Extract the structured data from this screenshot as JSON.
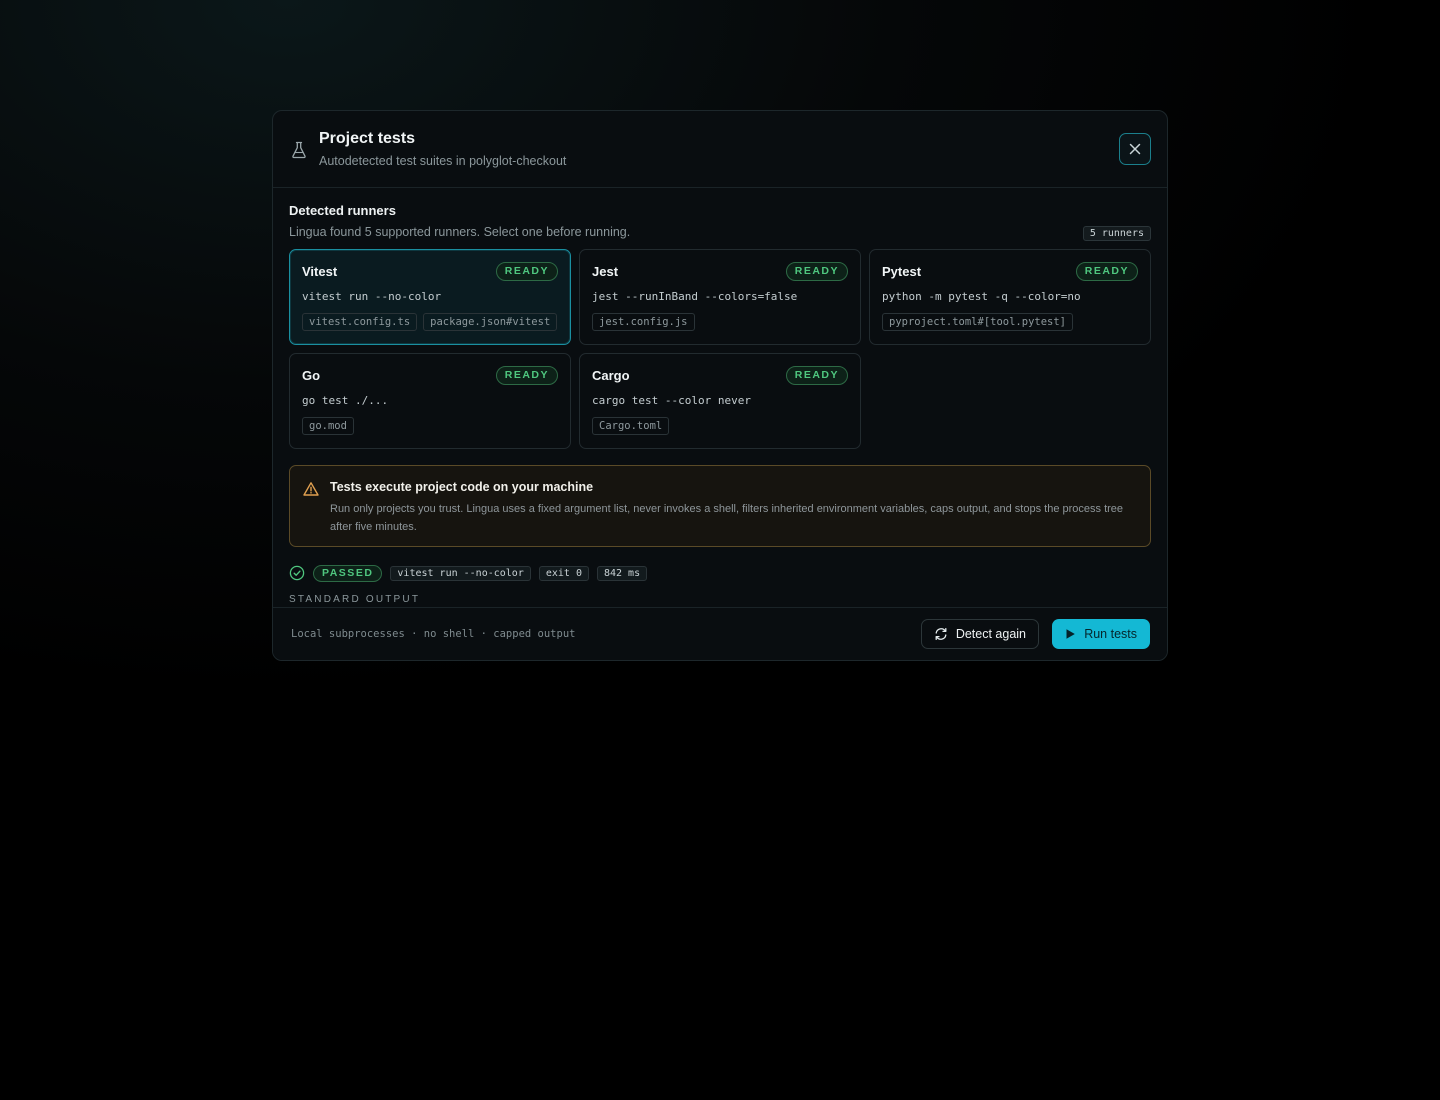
{
  "dialog": {
    "title": "Project tests",
    "subtitle": "Autodetected test suites in polyglot-checkout",
    "close_icon": "close-icon",
    "header_icon": "flask-icon"
  },
  "runners_section": {
    "title": "Detected runners",
    "description": "Lingua found 5 supported runners. Select one before running.",
    "count_badge": "5 runners",
    "selected": "Vitest",
    "runners": [
      {
        "name": "Vitest",
        "status": "READY",
        "command": "vitest run --no-color",
        "files": [
          "vitest.config.ts",
          "package.json#vitest"
        ]
      },
      {
        "name": "Jest",
        "status": "READY",
        "command": "jest --runInBand --colors=false",
        "files": [
          "jest.config.js"
        ]
      },
      {
        "name": "Pytest",
        "status": "READY",
        "command": "python -m pytest -q --color=no",
        "files": [
          "pyproject.toml#[tool.pytest]"
        ]
      },
      {
        "name": "Go",
        "status": "READY",
        "command": "go test ./...",
        "files": [
          "go.mod"
        ]
      },
      {
        "name": "Cargo",
        "status": "READY",
        "command": "cargo test --color never",
        "files": [
          "Cargo.toml"
        ]
      }
    ]
  },
  "warning": {
    "icon": "warning-triangle-icon",
    "title": "Tests execute project code on your machine",
    "body": "Run only projects you trust. Lingua uses a fixed argument list, never invokes a shell, filters inherited environment variables, caps output, and stops the process tree after five minutes."
  },
  "result": {
    "icon": "check-circle-icon",
    "status": "PASSED",
    "command": "vitest run --no-color",
    "exit": "exit 0",
    "duration": "842 ms",
    "stdout_label": "STANDARD OUTPUT"
  },
  "footer": {
    "note": "Local subprocesses · no shell · capped output",
    "detect_label": "Detect again",
    "run_label": "Run tests"
  },
  "colors": {
    "accent": "#14b8d4",
    "ready_green": "#4fc77f",
    "warning_amber": "#e0a050",
    "background": "#090d10"
  }
}
